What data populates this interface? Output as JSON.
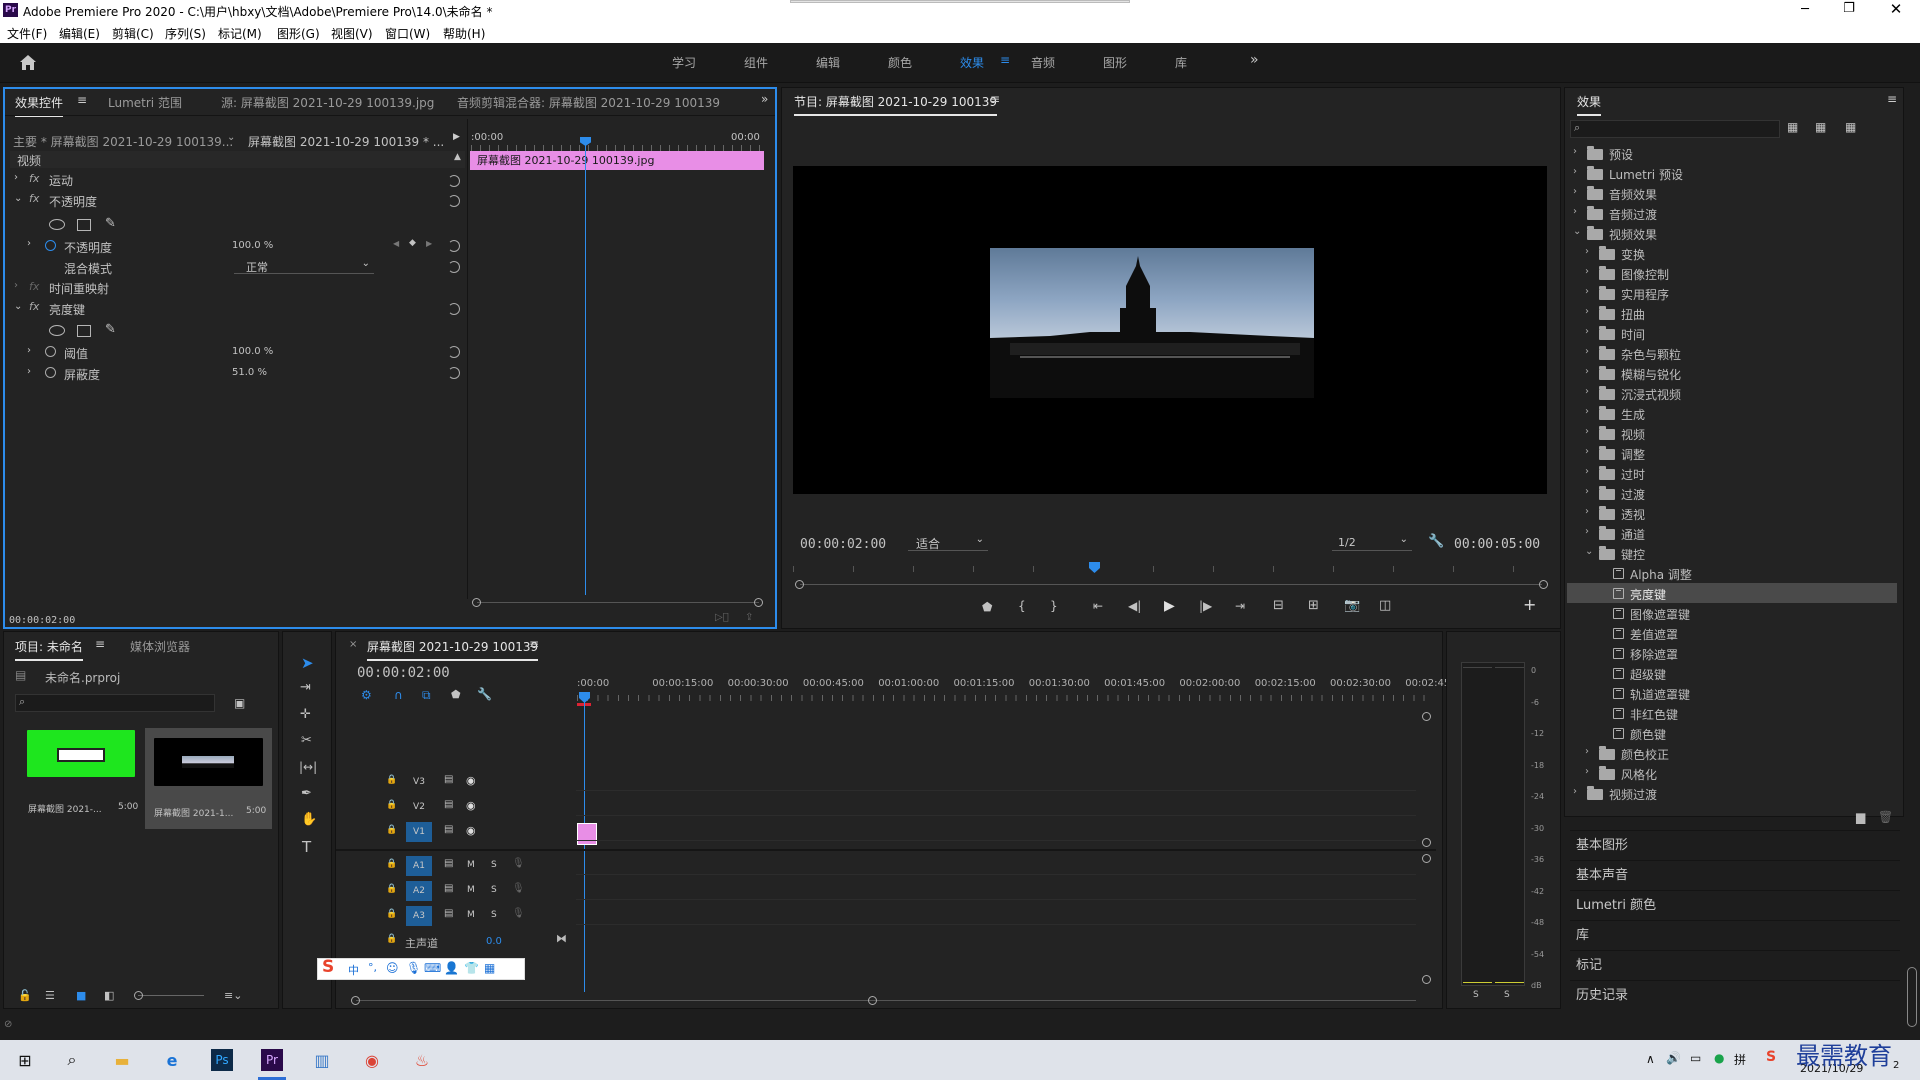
{
  "window": {
    "title": "Adobe Premiere Pro 2020 - C:\\用户\\hbxy\\文档\\Adobe\\Premiere Pro\\14.0\\未命名 *",
    "app_badge": "Pr"
  },
  "menu": [
    "文件(F)",
    "编辑(E)",
    "剪辑(C)",
    "序列(S)",
    "标记(M)",
    "图形(G)",
    "视图(V)",
    "窗口(W)",
    "帮助(H)"
  ],
  "workspaces": [
    "学习",
    "组件",
    "编辑",
    "颜色",
    "效果",
    "音频",
    "图形",
    "库"
  ],
  "workspace_active": "效果",
  "effect_controls": {
    "tabs": [
      "效果控件",
      "Lumetri 范围",
      "源: 屏幕截图 2021-10-29 100139.jpg",
      "音频剪辑混合器: 屏幕截图 2021-10-29 100139"
    ],
    "master": "主要 * 屏幕截图 2021-10-29 100139...",
    "clip": "屏幕截图 2021-10-29 100139 * ...",
    "section_video": "视频",
    "motion": "运动",
    "opacity_group": "不透明度",
    "opacity_label": "不透明度",
    "opacity_value": "100.0 %",
    "blend_label": "混合模式",
    "blend_value": "正常",
    "time_remap": "时间重映射",
    "luma_key": "亮度键",
    "threshold_label": "阈值",
    "threshold_value": "100.0 %",
    "cutoff_label": "屏蔽度",
    "cutoff_value": "51.0 %",
    "tl_start": ":00:00",
    "tl_end": "00:00",
    "clip_bar": "屏幕截图 2021-10-29  100139.jpg",
    "timecode": "00:00:02:00"
  },
  "program": {
    "title": "节目: 屏幕截图 2021-10-29 100139",
    "timecode": "00:00:02:00",
    "fit": "适合",
    "resolution": "1/2",
    "duration": "00:00:05:00"
  },
  "project": {
    "tabs": [
      "项目: 未命名",
      "媒体浏览器"
    ],
    "file": "未命名.prproj",
    "items": [
      {
        "name": "屏幕截图 2021-...",
        "dur": "5:00"
      },
      {
        "name": "屏幕截图 2021-1...",
        "dur": "5:00"
      }
    ]
  },
  "timeline": {
    "tab": "屏幕截图 2021-10-29 100139",
    "timecode": "00:00:02:00",
    "ruler": [
      ":00:00",
      "00:00:15:00",
      "00:00:30:00",
      "00:00:45:00",
      "00:01:00:00",
      "00:01:15:00",
      "00:01:30:00",
      "00:01:45:00",
      "00:02:00:00",
      "00:02:15:00",
      "00:02:30:00",
      "00:02:45:"
    ],
    "video_tracks": [
      "V3",
      "V2",
      "V1"
    ],
    "audio_tracks": [
      "A1",
      "A2",
      "A3"
    ],
    "master": "主声道",
    "master_value": "0.0",
    "m": "M",
    "s": "S"
  },
  "meter": {
    "scale": [
      "0",
      "-6",
      "-12",
      "-18",
      "-24",
      "-30",
      "-36",
      "-42",
      "-48",
      "-54",
      "dB"
    ],
    "s": "S"
  },
  "effects": {
    "title": "效果",
    "tree": [
      {
        "label": "预设",
        "level": 0,
        "type": "bin"
      },
      {
        "label": "Lumetri 预设",
        "level": 0,
        "type": "bin"
      },
      {
        "label": "音频效果",
        "level": 0,
        "type": "folder"
      },
      {
        "label": "音频过渡",
        "level": 0,
        "type": "folder"
      },
      {
        "label": "视频效果",
        "level": 0,
        "type": "folder",
        "open": true
      },
      {
        "label": "变换",
        "level": 1,
        "type": "folder"
      },
      {
        "label": "图像控制",
        "level": 1,
        "type": "folder"
      },
      {
        "label": "实用程序",
        "level": 1,
        "type": "folder"
      },
      {
        "label": "扭曲",
        "level": 1,
        "type": "folder"
      },
      {
        "label": "时间",
        "level": 1,
        "type": "folder"
      },
      {
        "label": "杂色与颗粒",
        "level": 1,
        "type": "folder"
      },
      {
        "label": "模糊与锐化",
        "level": 1,
        "type": "folder"
      },
      {
        "label": "沉浸式视频",
        "level": 1,
        "type": "folder"
      },
      {
        "label": "生成",
        "level": 1,
        "type": "folder"
      },
      {
        "label": "视频",
        "level": 1,
        "type": "folder"
      },
      {
        "label": "调整",
        "level": 1,
        "type": "folder"
      },
      {
        "label": "过时",
        "level": 1,
        "type": "folder"
      },
      {
        "label": "过渡",
        "level": 1,
        "type": "folder"
      },
      {
        "label": "透视",
        "level": 1,
        "type": "folder"
      },
      {
        "label": "通道",
        "level": 1,
        "type": "folder"
      },
      {
        "label": "键控",
        "level": 1,
        "type": "folder",
        "open": true
      },
      {
        "label": "Alpha 调整",
        "level": 2,
        "type": "fx"
      },
      {
        "label": "亮度键",
        "level": 2,
        "type": "fx",
        "selected": true
      },
      {
        "label": "图像遮罩键",
        "level": 2,
        "type": "fx"
      },
      {
        "label": "差值遮罩",
        "level": 2,
        "type": "fx"
      },
      {
        "label": "移除遮罩",
        "level": 2,
        "type": "fx"
      },
      {
        "label": "超级键",
        "level": 2,
        "type": "fx"
      },
      {
        "label": "轨道遮罩键",
        "level": 2,
        "type": "fx"
      },
      {
        "label": "非红色键",
        "level": 2,
        "type": "fx"
      },
      {
        "label": "颜色键",
        "level": 2,
        "type": "fx"
      },
      {
        "label": "颜色校正",
        "level": 1,
        "type": "folder"
      },
      {
        "label": "风格化",
        "level": 1,
        "type": "folder"
      },
      {
        "label": "视频过渡",
        "level": 0,
        "type": "folder"
      }
    ],
    "panels": [
      "基本图形",
      "基本声音",
      "Lumetri 颜色",
      "库",
      "标记",
      "历史记录"
    ]
  },
  "taskbar": {
    "date": "2021/10/29",
    "watermark": "最需教育",
    "badge": "2"
  },
  "colors": {
    "accent": "#2d8ceb",
    "clip_pink": "#e88ee6",
    "green_screen": "#1ee61e"
  }
}
